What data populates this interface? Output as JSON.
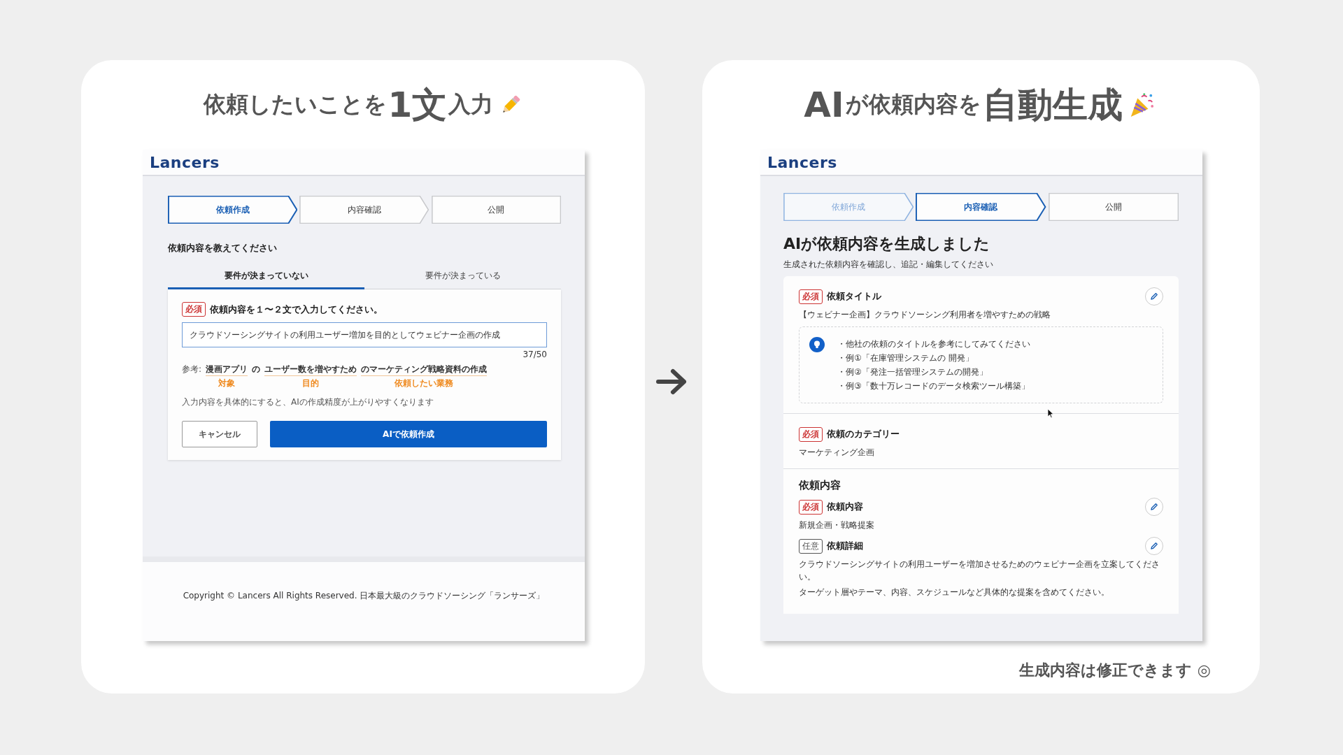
{
  "left_panel": {
    "title_parts": [
      {
        "text": "依頼したいことを",
        "emphasis": false
      },
      {
        "text": "1文",
        "emphasis": true
      },
      {
        "text": "入力",
        "emphasis": false
      }
    ],
    "screen": {
      "logo": "Lancers",
      "steps": [
        {
          "label": "依頼作成",
          "selected": true,
          "completed": false
        },
        {
          "label": "内容確認",
          "selected": false,
          "completed": false
        },
        {
          "label": "公開",
          "selected": false,
          "completed": false
        }
      ],
      "heading": "依頼内容を教えてください",
      "tabs": [
        {
          "label": "要件が決まっていない",
          "selected": true
        },
        {
          "label": "要件が決まっている",
          "selected": false
        }
      ],
      "form": {
        "badge": {
          "text": "必須",
          "kind": "required"
        },
        "label": "依頼内容を１〜２文で入力してください。",
        "input_value": "クラウドソーシングサイトの利用ユーザー増加を目的としてウェビナー企画の作成",
        "counter": "37/50",
        "example_prefix": "参考:",
        "example_parts": [
          {
            "text": "漫画アプリ",
            "note": "対象"
          },
          {
            "text": "の"
          },
          {
            "text": "ユーザー数を増やすため",
            "note": "目的"
          },
          {
            "text": "のマーケティング戦略資料の作成",
            "note": "依頼したい業務"
          }
        ],
        "hint": "入力内容を具体的にすると、AIの作成精度が上がりやすくなります",
        "buttons": [
          {
            "label": "キャンセル",
            "kind": "secondary"
          },
          {
            "label": "AIで依頼作成",
            "kind": "primary"
          }
        ]
      },
      "footer": "Copyright © Lancers All Rights Reserved. 日本最大級のクラウドソーシング「ランサーズ」"
    }
  },
  "right_panel": {
    "title_parts": [
      {
        "text": "AI",
        "emphasis": true
      },
      {
        "text": "が依頼内容を",
        "emphasis": false
      },
      {
        "text": "自動生成",
        "emphasis": true
      }
    ],
    "screen": {
      "logo": "Lancers",
      "steps": [
        {
          "label": "依頼作成",
          "selected": false,
          "completed": true
        },
        {
          "label": "内容確認",
          "selected": true,
          "completed": false
        },
        {
          "label": "公開",
          "selected": false,
          "completed": false
        }
      ],
      "heading": "AIが依頼内容を生成しました",
      "subheading": "生成された依頼内容を確認し、追記・編集してください",
      "sections": [
        {
          "kind": "field",
          "badge": {
            "text": "必須",
            "kind": "required"
          },
          "label": "依頼タイトル",
          "editable": true,
          "lines": [
            "【ウェビナー企画】クラウドソーシング利用者を増やすための戦略"
          ],
          "tips": [
            "・他社の依頼のタイトルを参考にしてみてください",
            "・例①「在庫管理システムの 開発」",
            "・例②「発注一括管理システムの開発」",
            "・例③「数十万レコードのデータ検索ツール構築」"
          ]
        },
        {
          "kind": "field",
          "badge": {
            "text": "必須",
            "kind": "required"
          },
          "label": "依頼のカテゴリー",
          "editable": false,
          "lines": [
            "マーケティング企画"
          ]
        },
        {
          "kind": "group",
          "heading": "依頼内容",
          "fields": [
            {
              "badge": {
                "text": "必須",
                "kind": "required"
              },
              "label": "依頼内容",
              "editable": true,
              "lines": [
                "新規企画・戦略提案"
              ]
            },
            {
              "badge": {
                "text": "任意",
                "kind": "optional"
              },
              "label": "依頼詳細",
              "editable": true,
              "lines": [
                "クラウドソーシングサイトの利用ユーザーを増加させるためのウェビナー企画を立案してください。",
                "ターゲット層やテーマ、内容、スケジュールなど具体的な提案を含めてください。"
              ]
            }
          ]
        }
      ]
    },
    "caption": "生成内容は修正できます ◎"
  }
}
